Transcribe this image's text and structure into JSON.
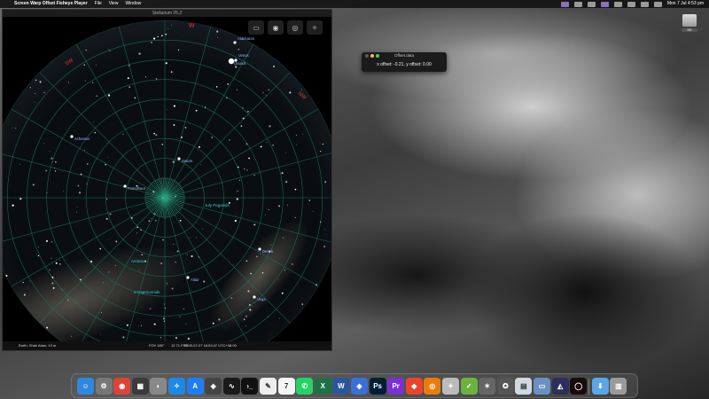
{
  "menubar": {
    "app_name": "Screen Warp Offset Fisheye Player",
    "menus": [
      "File",
      "View",
      "Window"
    ],
    "clock": "Mon 7 Jul  4:53 pm"
  },
  "stellarium": {
    "title": "Stellarium 25.2",
    "compass": [
      "W",
      "SW",
      "NW"
    ],
    "stars": [
      "Achernar",
      "Fomalhaut",
      "Saturn",
      "Deneb",
      "Altair",
      "Vega",
      "Aldebaran",
      "Uranus",
      "Venus"
    ],
    "constellation_labels": [
      "July Pegasids",
      "Arcturus",
      "α-Capricornids"
    ],
    "status": {
      "location": "Earth, Shah Alam, 13 m",
      "fov": "FOV 180°",
      "fps": "12.71 FPS",
      "datetime": "2025-07-07 16:53:47 UTC+08:00"
    },
    "colors": {
      "grid": "#1f7a5e",
      "compass": "#e33b2e",
      "star_label": "#9fb4ff",
      "constellation_label": "#2fd6d6"
    }
  },
  "offset_window": {
    "title": "Offset.data",
    "value": "x offset: -0.21, y offset: 0.00"
  },
  "drive": {
    "label": "HD"
  },
  "dock": [
    {
      "name": "finder-icon",
      "glyph": "☺",
      "color": "#2f88e0"
    },
    {
      "name": "system-settings-icon",
      "glyph": "⚙",
      "color": "#777"
    },
    {
      "name": "chrome-icon",
      "glyph": "◉",
      "color": "#db4437"
    },
    {
      "name": "calculator-icon",
      "glyph": "▦",
      "color": "#3a3a3a"
    },
    {
      "name": "disk-utility-icon",
      "glyph": "◐",
      "color": "#888"
    },
    {
      "name": "safari-icon",
      "glyph": "✧",
      "color": "#1e88e5"
    },
    {
      "name": "app-store-icon",
      "glyph": "A",
      "color": "#1d7ef5"
    },
    {
      "name": "app-icon",
      "glyph": "◈",
      "color": "#444"
    },
    {
      "name": "activity-monitor-icon",
      "glyph": "∿",
      "color": "#1a1a1a"
    },
    {
      "name": "terminal-icon",
      "glyph": "›_",
      "color": "#111"
    },
    {
      "name": "textedit-icon",
      "glyph": "✎",
      "color": "#eee"
    },
    {
      "name": "calendar-icon",
      "glyph": "7",
      "color": "#f5f5f5"
    },
    {
      "name": "whatsapp-icon",
      "glyph": "✆",
      "color": "#25d366"
    },
    {
      "name": "excel-icon",
      "glyph": "X",
      "color": "#1e7145"
    },
    {
      "name": "word-icon",
      "glyph": "W",
      "color": "#2b579a"
    },
    {
      "name": "app-icon-2",
      "glyph": "◆",
      "color": "#3b6fd8"
    },
    {
      "name": "photoshop-icon",
      "glyph": "Ps",
      "color": "#001e36"
    },
    {
      "name": "premiere-icon",
      "glyph": "Pr",
      "color": "#7b32d1"
    },
    {
      "name": "anydesk-icon",
      "glyph": "◆",
      "color": "#e8452c"
    },
    {
      "name": "blender-icon",
      "glyph": "◎",
      "color": "#e87d0d"
    },
    {
      "name": "app-icon-3",
      "glyph": "✦",
      "color": "#bbb"
    },
    {
      "name": "app-icon-4",
      "glyph": "✓",
      "color": "#6cb33e"
    },
    {
      "name": "app-icon-5",
      "glyph": "✶",
      "color": "#666"
    },
    {
      "name": "app-icon-6",
      "glyph": "✪",
      "color": "#555"
    },
    {
      "name": "preview-icon",
      "glyph": "▤",
      "color": "#cfd8e3"
    },
    {
      "name": "screen-app-icon",
      "glyph": "▭",
      "color": "#6b8fc6"
    },
    {
      "name": "stellarium-icon",
      "glyph": "◭",
      "color": "#2c2f5a"
    },
    {
      "name": "fisheye-player-icon",
      "glyph": "◯",
      "color": "#1a0a0a"
    },
    {
      "name": "downloads-folder-icon",
      "glyph": "⬇",
      "color": "#5aa7e6"
    },
    {
      "name": "trash-icon",
      "glyph": "▥",
      "color": "#9a9a9a"
    }
  ]
}
